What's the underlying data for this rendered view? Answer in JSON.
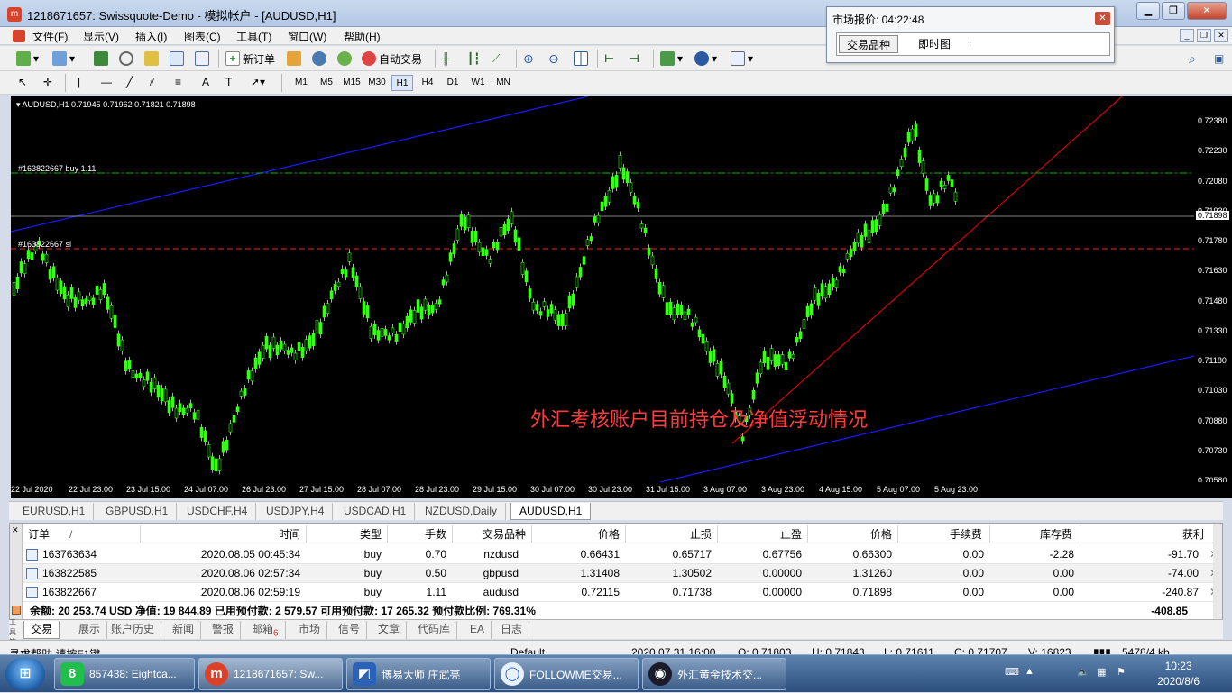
{
  "window": {
    "title": "1218671657: Swissquote-Demo - 模拟帐户 - [AUDUSD,H1]"
  },
  "menu": [
    "文件(F)",
    "显示(V)",
    "插入(I)",
    "图表(C)",
    "工具(T)",
    "窗口(W)",
    "帮助(H)"
  ],
  "toolbar": {
    "new_order": "新订单",
    "auto_trade": "自动交易"
  },
  "timeframes": [
    "M1",
    "M5",
    "M15",
    "M30",
    "H1",
    "H4",
    "D1",
    "W1",
    "MN"
  ],
  "timeframe_active": "H1",
  "chart": {
    "header": "AUDUSD,H1  0.71945 0.71962 0.71821 0.71898",
    "buy_line_label": "#163822667 buy 1.11",
    "sl_line_label": "#163822667 sl",
    "annotation": "外汇考核账户目前持仓及净值浮动情况",
    "price_labels": [
      "0.72380",
      "0.72230",
      "0.72080",
      "0.71930",
      "0.71780",
      "0.71630",
      "0.71480",
      "0.71330",
      "0.71180",
      "0.71030",
      "0.70880",
      "0.70730",
      "0.70580"
    ],
    "current_price": "0.71898",
    "date_labels": [
      "22 Jul 2020",
      "22 Jul 23:00",
      "23 Jul 15:00",
      "24 Jul 07:00",
      "26 Jul 23:00",
      "27 Jul 15:00",
      "28 Jul 07:00",
      "28 Jul 23:00",
      "29 Jul 15:00",
      "30 Jul 07:00",
      "30 Jul 23:00",
      "31 Jul 15:00",
      "3 Aug 07:00",
      "3 Aug 23:00",
      "4 Aug 15:00",
      "5 Aug 07:00",
      "5 Aug 23:00"
    ],
    "colors": {
      "candles": "#39ff14",
      "trendline_red": "#ff0000",
      "trendline_blue": "#1a1aff",
      "buy_line": "#00c000",
      "sl_line": "#ff2020"
    }
  },
  "chart_tabs": [
    "EURUSD,H1",
    "GBPUSD,H1",
    "USDCHF,H4",
    "USDJPY,H4",
    "USDCAD,H1",
    "NZDUSD,Daily",
    "AUDUSD,H1"
  ],
  "chart_tab_active": "AUDUSD,H1",
  "terminal": {
    "headers": [
      "订单",
      "/",
      "时间",
      "类型",
      "手数",
      "交易品种",
      "价格",
      "止损",
      "止盈",
      "价格",
      "手续费",
      "库存费",
      "获利"
    ],
    "rows": [
      {
        "order": "163763634",
        "time": "2020.08.05 00:45:34",
        "type": "buy",
        "lots": "0.70",
        "symbol": "nzdusd",
        "price": "0.66431",
        "sl": "0.65717",
        "tp": "0.67756",
        "cur": "0.66300",
        "commission": "0.00",
        "swap": "-2.28",
        "profit": "-91.70"
      },
      {
        "order": "163822585",
        "time": "2020.08.06 02:57:34",
        "type": "buy",
        "lots": "0.50",
        "symbol": "gbpusd",
        "price": "1.31408",
        "sl": "1.30502",
        "tp": "0.00000",
        "cur": "1.31260",
        "commission": "0.00",
        "swap": "0.00",
        "profit": "-74.00"
      },
      {
        "order": "163822667",
        "time": "2020.08.06 02:59:19",
        "type": "buy",
        "lots": "1.11",
        "symbol": "audusd",
        "price": "0.72115",
        "sl": "0.71738",
        "tp": "0.00000",
        "cur": "0.71898",
        "commission": "0.00",
        "swap": "0.00",
        "profit": "-240.87"
      }
    ],
    "summary": "余额: 20 253.74 USD  净值: 19 844.89  已用预付款: 2 579.57  可用预付款: 17 265.32  预付款比例: 769.31%",
    "summary_profit": "-408.85"
  },
  "bottom_tabs": [
    "交易",
    "展示",
    "账户历史",
    "新闻",
    "警报",
    "邮箱",
    "市场",
    "信号",
    "文章",
    "代码库",
    "EA",
    "日志"
  ],
  "bottom_tab_active": "交易",
  "mailbox_badge": "6",
  "toolbox_label": "工具箱",
  "status": {
    "help": "寻求帮助,请按F1键",
    "profile": "Default",
    "time": "2020.07.31 16:00",
    "open": "O: 0.71803",
    "high": "H: 0.71843",
    "low": "L: 0.71611",
    "close": "C: 0.71707",
    "volume": "V: 16823",
    "traffic": "5478/4 kb"
  },
  "quote_window": {
    "title": "市场报价: 04:22:48",
    "tabs": [
      "交易品种",
      "即时图"
    ]
  },
  "taskbar": {
    "tasks": [
      "857438: Eightca...",
      "1218671657: Sw...",
      "博易大师 庄武亮",
      "FOLLOWME交易...",
      "外汇黄金技术交..."
    ],
    "clock_time": "10:23",
    "clock_date": "2020/8/6"
  }
}
